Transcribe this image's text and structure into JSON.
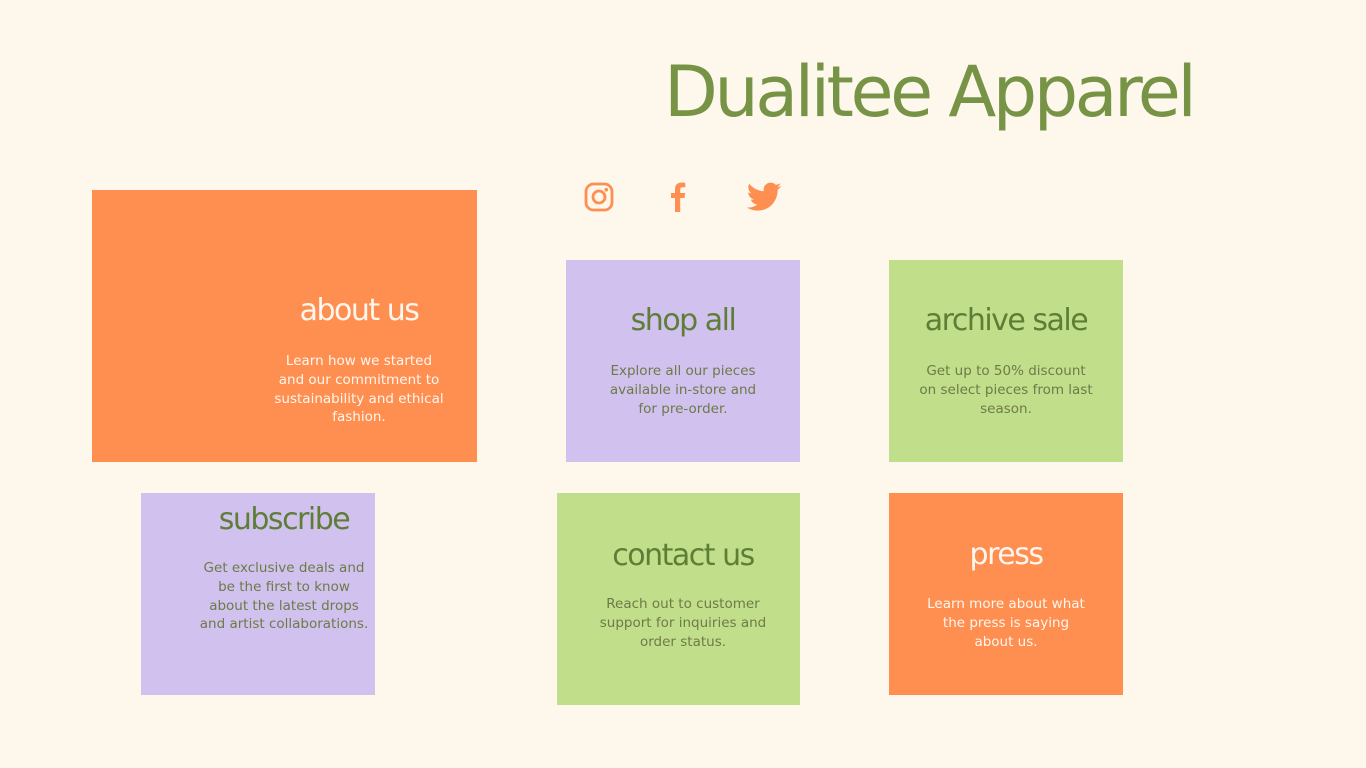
{
  "brand": {
    "title": "Dualitee Apparel",
    "color": "#779446"
  },
  "social": [
    {
      "name": "Instagram",
      "icon": "instagram-icon"
    },
    {
      "name": "Facebook",
      "icon": "facebook-icon"
    },
    {
      "name": "Twitter",
      "icon": "twitter-icon"
    }
  ],
  "cards": {
    "about": {
      "title": "about us",
      "description": "Learn how we started and our commitment to sustainability and ethical fashion."
    },
    "shop": {
      "title": "shop all",
      "description": "Explore all our pieces available in-store and for pre-order."
    },
    "archive": {
      "title": "archive sale",
      "description": "Get up to 50% discount on select pieces from last season."
    },
    "subscribe": {
      "title": "subscribe",
      "description": "Get exclusive deals and be the first to know about the latest drops and artist collaborations."
    },
    "contact": {
      "title": "contact us",
      "description": "Reach out to customer support for inquiries and order status."
    },
    "press": {
      "title": "press",
      "description": "Learn more about what the press is saying about us."
    }
  },
  "colors": {
    "background": "#fef7ec",
    "orange": "#ff8f51",
    "purple": "#d1c1ef",
    "green": "#c1df8b",
    "text_dark": "#5e7e37",
    "text_light": "#fff6ee"
  }
}
